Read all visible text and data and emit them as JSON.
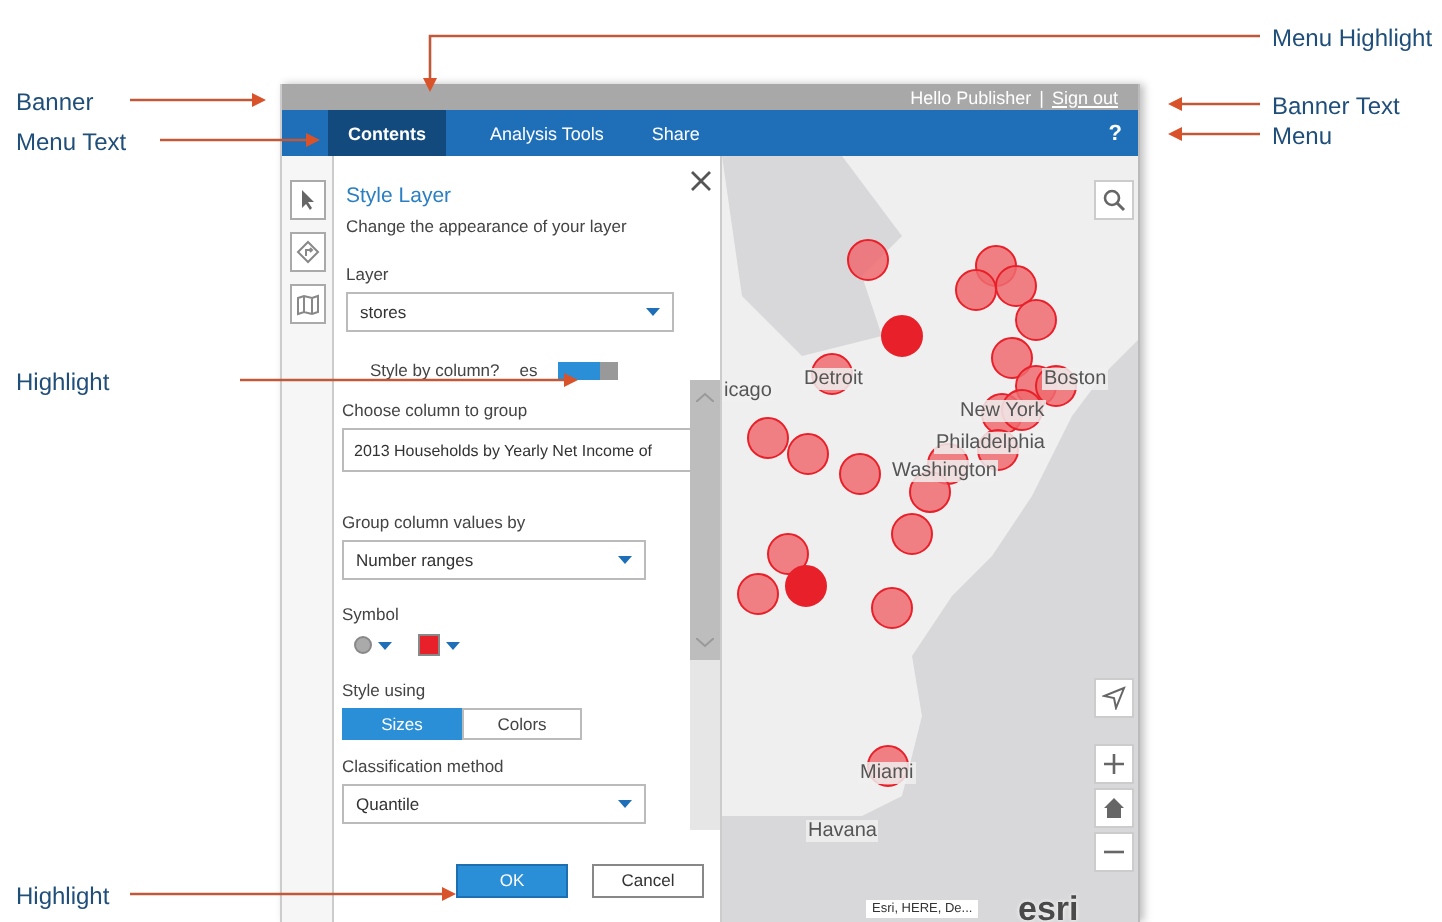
{
  "annotations": {
    "left": [
      {
        "text": "Banner"
      },
      {
        "text": "Menu Text"
      },
      {
        "text": "Highlight"
      },
      {
        "text": "Highlight"
      }
    ],
    "right": [
      {
        "text": "Menu Highlight"
      },
      {
        "text": "Banner Text"
      },
      {
        "text": "Menu"
      }
    ]
  },
  "banner": {
    "greeting": "Hello Publisher",
    "separator": "|",
    "sign_out": "Sign out"
  },
  "menu": {
    "tabs": [
      {
        "label": "Contents",
        "selected": true
      },
      {
        "label": "Analysis Tools",
        "selected": false
      },
      {
        "label": "Share",
        "selected": false
      }
    ],
    "help": "?"
  },
  "panel": {
    "title": "Style Layer",
    "subtitle": "Change the appearance of your layer",
    "layer_label": "Layer",
    "layer_value": "stores",
    "style_by_column": {
      "label": "Style by column?",
      "toggle_text": "es",
      "on": true
    },
    "column_label": "Choose column to group",
    "column_value": "2013 Households by Yearly Net Income of",
    "group_label": "Group column values by",
    "group_value": "Number ranges",
    "symbol_label": "Symbol",
    "style_using_label": "Style using",
    "style_using": [
      {
        "label": "Sizes",
        "selected": true
      },
      {
        "label": "Colors",
        "selected": false
      }
    ],
    "classification_label": "Classification method",
    "classification_value": "Quantile",
    "buttons": {
      "ok": "OK",
      "cancel": "Cancel"
    }
  },
  "map": {
    "labels": [
      "icago",
      "Detroit",
      "Boston",
      "New York",
      "Philadelphia",
      "Washington",
      "Miami",
      "Havana"
    ],
    "attribution": "Esri, HERE, De...",
    "logo": "esri"
  }
}
